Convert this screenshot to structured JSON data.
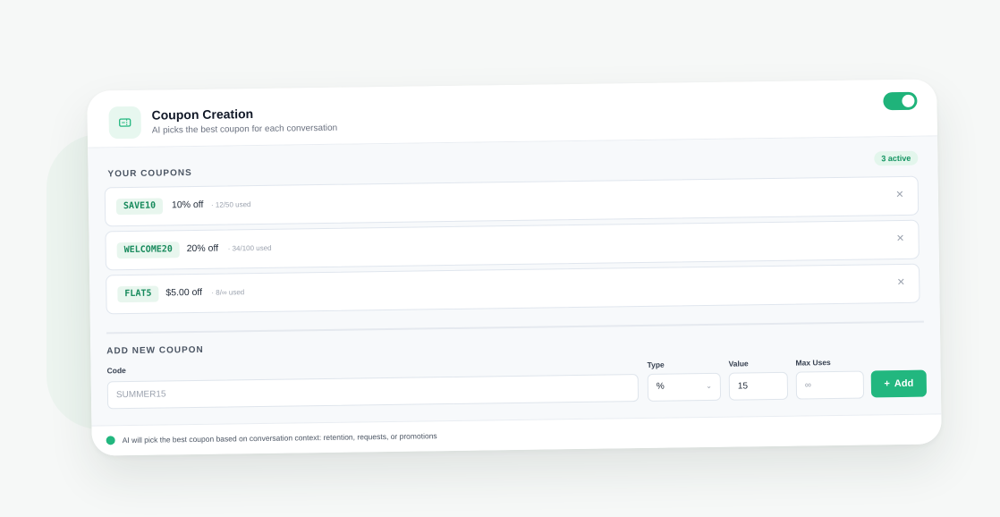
{
  "header": {
    "title": "Coupon Creation",
    "subtitle": "AI picks the best coupon for each conversation",
    "icon": "ticket-icon",
    "toggle_on": true
  },
  "coupons": {
    "section_label": "YOUR COUPONS",
    "active_badge": "3 active",
    "items": [
      {
        "code": "SAVE10",
        "discount": "10% off",
        "usage": "· 12/50 used"
      },
      {
        "code": "WELCOME20",
        "discount": "20% off",
        "usage": "· 34/100 used"
      },
      {
        "code": "FLAT5",
        "discount": "$5.00 off",
        "usage": "· 8/∞ used"
      }
    ]
  },
  "new_coupon": {
    "section_label": "ADD NEW COUPON",
    "code_label": "Code",
    "code_placeholder": "SUMMER15",
    "type_label": "Type",
    "type_value": "%",
    "value_label": "Value",
    "value_value": "15",
    "max_uses_label": "Max Uses",
    "max_uses_placeholder": "∞",
    "add_label": "Add"
  },
  "footer": {
    "text": "AI will pick the best coupon based on conversation context: retention, requests, or promotions"
  },
  "colors": {
    "accent": "#22b77f",
    "accent_light": "#e8f6ee",
    "text_dark": "#111827"
  }
}
